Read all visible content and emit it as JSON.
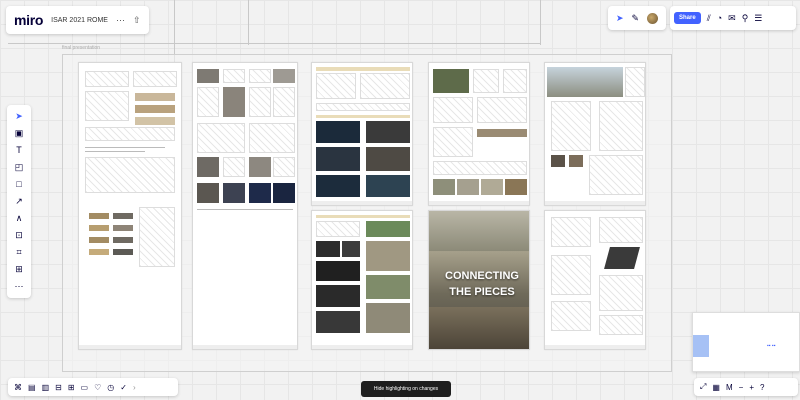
{
  "header": {
    "logo": "miro",
    "board_title": "ISAR 2021 ROME",
    "more_icon": "ellipsis-icon",
    "export_icon": "upload-icon"
  },
  "top_right": {
    "reactions_icon": "cursor-icon",
    "pen_icon": "pen-icon",
    "share_label": "Share",
    "tools": [
      "present-icon",
      "timer-icon",
      "comment-icon",
      "search-icon"
    ],
    "menu_icon": "menu-icon"
  },
  "left_toolbar": {
    "tools": [
      "select-icon",
      "frame-icon",
      "text-icon",
      "sticky-note-icon",
      "shape-icon",
      "arrow-icon",
      "pen-icon",
      "comment-icon",
      "crop-frame-icon",
      "upload-icon",
      "more-icon"
    ]
  },
  "canvas": {
    "frame_label": "final presentation",
    "poster_caption_line1": "CONNECTING",
    "poster_caption_line2": "THE PIECES"
  },
  "bottom_toolbar": {
    "tools": [
      "grid-icon",
      "card-icon",
      "layout-icon",
      "board-icon",
      "template-icon",
      "sticky-icon",
      "like-icon",
      "timer-icon",
      "vote-icon",
      "chevron-icon"
    ]
  },
  "toast": "Hide highlighting on changes",
  "zoom_controls": {
    "fit_icon": "fit-icon",
    "map_icon": "map-icon",
    "minus_label": "−",
    "plus_label": "+",
    "zoom_label": "M",
    "help_icon": "help-icon"
  },
  "colors": {
    "accent": "#4262ff",
    "toast_bg": "#1e1e1e",
    "canvas_bg": "#f2f2f2"
  }
}
